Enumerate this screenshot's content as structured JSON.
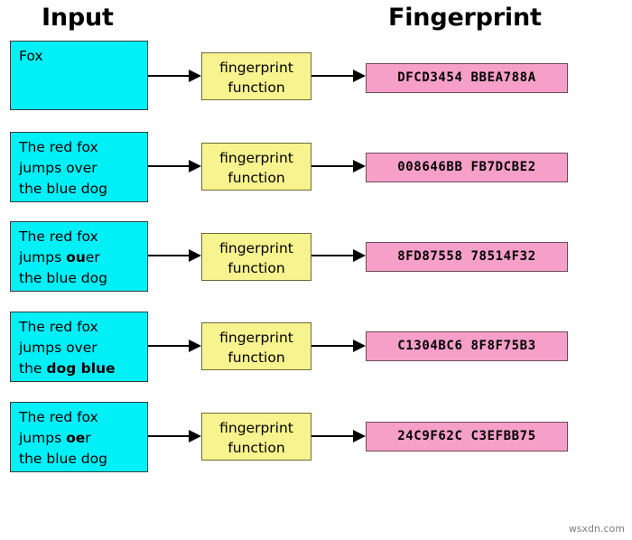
{
  "headers": {
    "input": "Input",
    "fingerprint": "Fingerprint"
  },
  "function_label_line1": "fingerprint",
  "function_label_line2": "function",
  "watermark": "wsxdn.com",
  "colors": {
    "input_box_fill": "#00f0f8",
    "input_box_border": "#3a3a3a",
    "function_box_fill": "#f7f38e",
    "function_box_border": "#6e6a3a",
    "hash_box_fill": "#f69fc8",
    "hash_box_border": "#6f4a5c",
    "arrow": "#000000",
    "text": "#000000",
    "background": "#ffffff"
  },
  "rows": [
    {
      "id": "row-1",
      "input_plain": "Fox",
      "input_lines": [
        [
          {
            "text": "Fox",
            "bold": false
          }
        ]
      ],
      "fingerprint": "DFCD3454 BBEA788A"
    },
    {
      "id": "row-2",
      "input_plain": "The red fox jumps over the blue dog",
      "input_lines": [
        [
          {
            "text": "The red fox",
            "bold": false
          }
        ],
        [
          {
            "text": "jumps over",
            "bold": false
          }
        ],
        [
          {
            "text": "the blue dog",
            "bold": false
          }
        ]
      ],
      "fingerprint": "008646BB FB7DCBE2"
    },
    {
      "id": "row-3",
      "input_plain": "The red fox jumps ouer the blue dog",
      "input_lines": [
        [
          {
            "text": "The red fox",
            "bold": false
          }
        ],
        [
          {
            "text": "jumps ",
            "bold": false
          },
          {
            "text": "ou",
            "bold": true
          },
          {
            "text": "er",
            "bold": false
          }
        ],
        [
          {
            "text": "the blue dog",
            "bold": false
          }
        ]
      ],
      "fingerprint": "8FD87558 78514F32"
    },
    {
      "id": "row-4",
      "input_plain": "The red fox jumps over the dog blue",
      "input_lines": [
        [
          {
            "text": "The red fox",
            "bold": false
          }
        ],
        [
          {
            "text": "jumps over",
            "bold": false
          }
        ],
        [
          {
            "text": "the ",
            "bold": false
          },
          {
            "text": "dog blue",
            "bold": true
          }
        ]
      ],
      "fingerprint": "C1304BC6 8F8F75B3"
    },
    {
      "id": "row-5",
      "input_plain": "The red fox jumps oer the blue dog",
      "input_lines": [
        [
          {
            "text": "The red fox",
            "bold": false
          }
        ],
        [
          {
            "text": "jumps ",
            "bold": false
          },
          {
            "text": "oe",
            "bold": true
          },
          {
            "text": "r",
            "bold": false
          }
        ],
        [
          {
            "text": "the blue dog",
            "bold": false
          }
        ]
      ],
      "fingerprint": "24C9F62C C3EFBB75"
    }
  ],
  "layout": {
    "row_tops": [
      45,
      146,
      245,
      345,
      445
    ],
    "input_heights": [
      77,
      78,
      78,
      78,
      78
    ],
    "fn_tops": [
      58,
      158,
      258,
      357,
      457
    ],
    "hash_tops": [
      70,
      169,
      268,
      367,
      467
    ],
    "arrow_tops": [
      77,
      177,
      276,
      376,
      476
    ]
  }
}
